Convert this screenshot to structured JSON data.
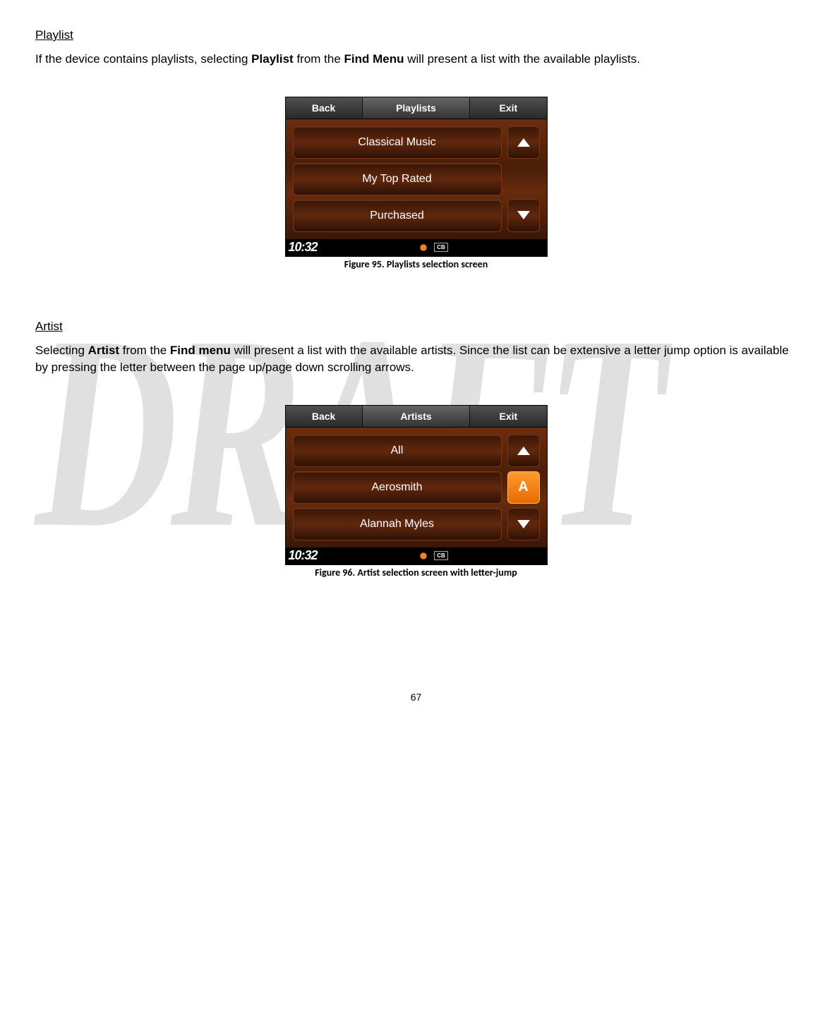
{
  "watermark": "DRAFT",
  "section1": {
    "title": "Playlist",
    "para_pre": "If the device contains playlists, selecting ",
    "para_bold1": "Playlist",
    "para_mid": " from the ",
    "para_bold2": "Find Menu",
    "para_post": " will present a list with the available playlists."
  },
  "fig1": {
    "back": "Back",
    "title": "Playlists",
    "exit": "Exit",
    "items": [
      "Classical Music",
      "My Top Rated",
      "Purchased"
    ],
    "clock": "10:32",
    "cb": "CB",
    "caption": "Figure 95. Playlists selection screen"
  },
  "section2": {
    "title": "Artist",
    "para_pre": "Selecting ",
    "para_bold1": "Artist",
    "para_mid": " from the ",
    "para_bold2": "Find menu",
    "para_post": " will present a list with the available artists. Since the list can be extensive a letter jump option is available by pressing the letter between the page up/page down scrolling arrows."
  },
  "fig2": {
    "back": "Back",
    "title": "Artists",
    "exit": "Exit",
    "items": [
      "All",
      "Aerosmith",
      "Alannah Myles"
    ],
    "letter": "A",
    "clock": "10:32",
    "cb": "CB",
    "caption": "Figure 96. Artist selection screen with letter-jump"
  },
  "page_number": "67"
}
